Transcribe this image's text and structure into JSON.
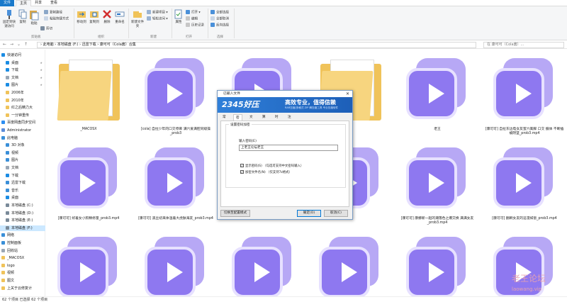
{
  "ribbon": {
    "tabs": [
      "文件",
      "主页",
      "共享",
      "查看"
    ],
    "buttons": {
      "pin": "固定到快速访问",
      "copy": "复制",
      "paste": "粘贴",
      "cut": "剪切",
      "copy_path": "复制路径",
      "paste_shortcut": "粘贴快捷方式",
      "move_to": "移动到",
      "copy_to": "复制到",
      "delete": "删除",
      "rename": "重命名",
      "new_folder": "新建文件夹",
      "new_item": "新建项目 ▾",
      "easy_access": "轻松访问 ▾",
      "properties": "属性",
      "open": "打开 ▾",
      "edit": "编辑",
      "history": "历史记录",
      "select_all": "全部选择",
      "select_none": "全部取消",
      "invert": "反向选择"
    },
    "groups": [
      "剪贴板",
      "组织",
      "新建",
      "打开",
      "选择"
    ]
  },
  "address": {
    "path": "›  此电脑  ›  本地磁盘 (F:)  ›  迅雷下载  ›  康可可（Cola酱）合集",
    "search_placeholder": "在 康可可（Cola酱）... "
  },
  "navpane": {
    "items": [
      {
        "label": "快速访问",
        "color": "#1b8ce3"
      },
      {
        "label": "桌面",
        "color": "#1b8ce3"
      },
      {
        "label": "下载",
        "color": "#1b8ce3"
      },
      {
        "label": "文档",
        "color": "#9ba7b5"
      },
      {
        "label": "图片",
        "color": "#1b8ce3"
      },
      {
        "label": "2006年",
        "color": "#f0c35a"
      },
      {
        "label": "2010年",
        "color": "#f0c35a"
      },
      {
        "label": "红之后精力大",
        "color": "#f0c35a"
      },
      {
        "label": "一分钟重传",
        "color": "#f0c35a"
      },
      {
        "label": "百度网盘同步空间",
        "color": "#2c8ef2"
      },
      {
        "label": "Administrator",
        "color": "#5b8bd9"
      },
      {
        "label": "此电脑",
        "color": "#3a8fd8"
      },
      {
        "label": "3D 对象",
        "color": "#3a8fd8"
      },
      {
        "label": "视频",
        "color": "#3a8fd8"
      },
      {
        "label": "图片",
        "color": "#3a8fd8"
      },
      {
        "label": "文档",
        "color": "#9ba7b5"
      },
      {
        "label": "下载",
        "color": "#1b8ce3"
      },
      {
        "label": "迅雷下载",
        "color": "#3a8fd8"
      },
      {
        "label": "音乐",
        "color": "#3a8fd8"
      },
      {
        "label": "桌面",
        "color": "#1b8ce3"
      },
      {
        "label": "本地磁盘 (C:)",
        "color": "#7a8a99"
      },
      {
        "label": "本地磁盘 (D:)",
        "color": "#7a8a99"
      },
      {
        "label": "本地磁盘 (E:)",
        "color": "#7a8a99"
      },
      {
        "label": "本地磁盘 (F:)",
        "color": "#7a8a99"
      },
      {
        "label": "网络",
        "color": "#3a8fd8"
      },
      {
        "label": "控制面板",
        "color": "#3a8fd8"
      },
      {
        "label": "回收站",
        "color": "#9ba7b5"
      },
      {
        "label": "_MACOSX",
        "color": "#f0c35a"
      },
      {
        "label": "logo",
        "color": "#f0c35a"
      },
      {
        "label": "视频",
        "color": "#f0c35a"
      },
      {
        "label": "图文",
        "color": "#f0c35a"
      },
      {
        "label": "上关于云修复计",
        "color": "#f0c35a"
      }
    ]
  },
  "files": {
    "row1": [
      "_MACOSX",
      "[cola] 自拉少年的口交停麻 满穴爱满腔同级操 _prob3",
      "",
      "",
      "老王",
      "[康可可] 自拉东边电女友蜜穴美脚 口交 摄体 不断插被阴茎_prob3.mp4",
      "[康可可] 暖屏露风人的阿稿赚号_prob3.mp4"
    ],
    "row2": [
      "[康可可] 好着女小狗精修量_prob3.mp4",
      "[康可可] 黑丝初来体温着大虎肤海友_prob3.mp4",
      "",
      "",
      "[康可可] 康娜新一起的潮落色之爆交换 满满女友_prob3.mp4",
      "[康可可] 翻刷女友的淫漫如窗_prob3.mp4",
      "[康可可] 掉地的狗得当力释放女式_prob3.mp4"
    ],
    "row3": [
      "",
      "",
      "",
      "",
      "",
      "",
      ""
    ]
  },
  "status": {
    "text": "62 个项目    已选择 62 个项目"
  },
  "watermark": {
    "line1": "老王论坛",
    "line2": "laowang.vip"
  },
  "dialog": {
    "title": "已输入文件",
    "logo": "2345好压",
    "slogan": "高效专业，值得信赖",
    "slogan_sub": "RAR压缩/多格式 ZIP 解压缩工具 专业压缩软件",
    "tabs": [
      "常规",
      "密码",
      "文件",
      "算法",
      "时间",
      "注释"
    ],
    "fieldset_label": "设置密码加密",
    "password_label": "输入密码(E)",
    "password_value": "上老王论坛老王",
    "check1": "显示密码(S)  （勾选可支持中文密码输入）",
    "check2": "加密文件名(N)  （仅支持7z格式）",
    "btn_profile": "切换至配置模式",
    "btn_ok": "确定(O)",
    "btn_cancel": "取消(C)"
  }
}
